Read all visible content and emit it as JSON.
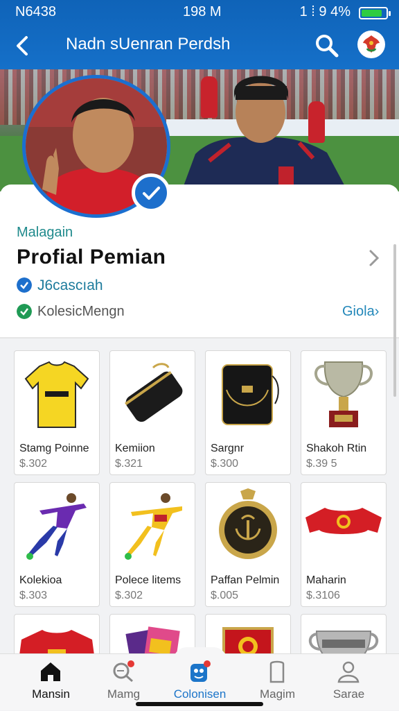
{
  "status_bar": {
    "left": "N6438",
    "center": "198 M",
    "right": "1 ⁞ 9 4%",
    "battery_level": 0.85
  },
  "header": {
    "title": "Nadn sUenran Perdsh"
  },
  "profile": {
    "category": "Malagain",
    "name": "Profial  Pemian",
    "verified_label": "J6cascıah",
    "collection_label": "KolesicMengn",
    "more_link": "Giola"
  },
  "products": [
    {
      "label": "Stamg Poinne",
      "price": "$.302",
      "icon": "yellow-jersey-icon"
    },
    {
      "label": "Kemiion",
      "price": "$.321",
      "icon": "black-clutch-icon"
    },
    {
      "label": "Sargnr",
      "price": "$.300",
      "icon": "black-bag-icon"
    },
    {
      "label": "Shakoh Rtin",
      "price": "$.39 5",
      "icon": "trophy-icon"
    },
    {
      "label": "Kolekioa",
      "price": "$.303",
      "icon": "purple-player-figure-icon"
    },
    {
      "label": "Polece litems",
      "price": "$.302",
      "icon": "yellow-player-figure-icon"
    },
    {
      "label": "Paffan Pelmin",
      "price": "$.005",
      "icon": "gold-medal-icon"
    },
    {
      "label": "Maharin",
      "price": "$.3106",
      "icon": "red-shirt-icon"
    },
    {
      "label": "",
      "price": "",
      "icon": "red-jersey-icon"
    },
    {
      "label": "",
      "price": "",
      "icon": "magazine-icon"
    },
    {
      "label": "",
      "price": "",
      "icon": "red-badge-icon"
    },
    {
      "label": "",
      "price": "",
      "icon": "silver-cup-icon"
    }
  ],
  "nav": [
    {
      "label": "Mansin",
      "icon": "home-icon"
    },
    {
      "label": "Mamg",
      "icon": "search-chat-icon"
    },
    {
      "label": "Colonisen",
      "icon": "collection-icon"
    },
    {
      "label": "Magim",
      "icon": "bookmark-icon"
    },
    {
      "label": "Sarae",
      "icon": "person-icon"
    }
  ],
  "colors": {
    "primary": "#1570c9",
    "teal": "#1f8a8c",
    "accent_blue": "#1d6fcc",
    "green_check": "#1f9a55"
  }
}
